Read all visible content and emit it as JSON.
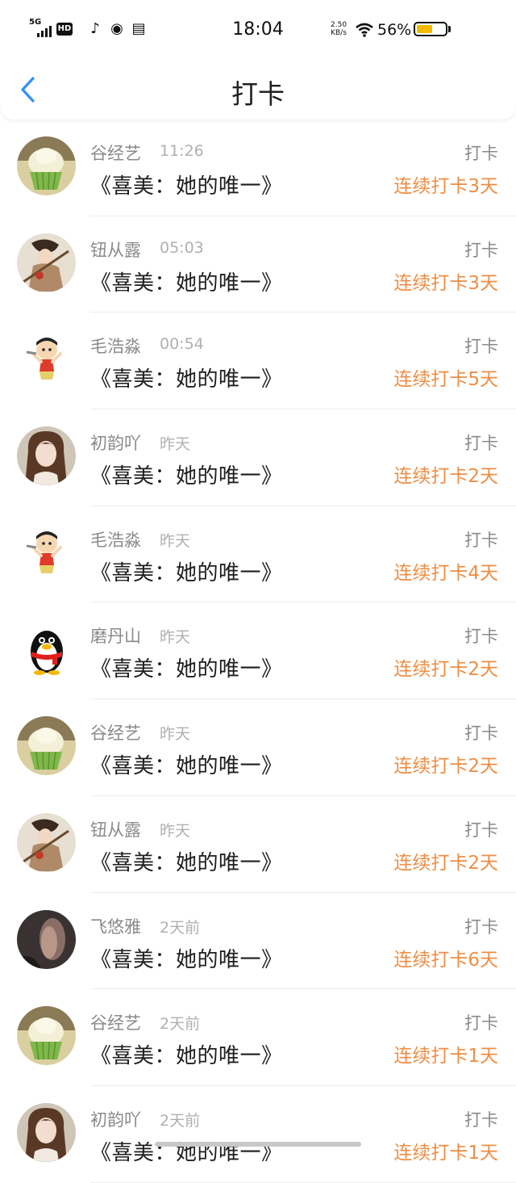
{
  "status_bar": {
    "network": "5G",
    "hd_label": "HD",
    "time": "18:04",
    "speed_value": "2.50",
    "speed_unit": "KB/s",
    "battery_text": "56%",
    "battery_level": 0.56,
    "battery_color": "#f5b800"
  },
  "header": {
    "title": "打卡",
    "back_icon": "chevron-left-icon",
    "accent": "#2f8fff"
  },
  "colors": {
    "streak": "#ee8e45",
    "muted": "#8a8a8a"
  },
  "items": [
    {
      "name": "谷经艺",
      "time": "11:26",
      "book": "《喜美：她的唯一》",
      "action": "打卡",
      "streak": "连续打卡3天",
      "avatar": "cupcake"
    },
    {
      "name": "钮从露",
      "time": "05:03",
      "book": "《喜美：她的唯一》",
      "action": "打卡",
      "streak": "连续打卡3天",
      "avatar": "warrior"
    },
    {
      "name": "毛浩淼",
      "time": "00:54",
      "book": "《喜美：她的唯一》",
      "action": "打卡",
      "streak": "连续打卡5天",
      "avatar": "cartoon-kid"
    },
    {
      "name": "初韵吖",
      "time": "昨天",
      "book": "《喜美：她的唯一》",
      "action": "打卡",
      "streak": "连续打卡2天",
      "avatar": "girl"
    },
    {
      "name": "毛浩淼",
      "time": "昨天",
      "book": "《喜美：她的唯一》",
      "action": "打卡",
      "streak": "连续打卡4天",
      "avatar": "cartoon-kid"
    },
    {
      "name": "磨丹山",
      "time": "昨天",
      "book": "《喜美：她的唯一》",
      "action": "打卡",
      "streak": "连续打卡2天",
      "avatar": "penguin"
    },
    {
      "name": "谷经艺",
      "time": "昨天",
      "book": "《喜美：她的唯一》",
      "action": "打卡",
      "streak": "连续打卡2天",
      "avatar": "cupcake"
    },
    {
      "name": "钮从露",
      "time": "昨天",
      "book": "《喜美：她的唯一》",
      "action": "打卡",
      "streak": "连续打卡2天",
      "avatar": "warrior"
    },
    {
      "name": "飞悠雅",
      "time": "2天前",
      "book": "《喜美：她的唯一》",
      "action": "打卡",
      "streak": "连续打卡6天",
      "avatar": "dark-photo"
    },
    {
      "name": "谷经艺",
      "time": "2天前",
      "book": "《喜美：她的唯一》",
      "action": "打卡",
      "streak": "连续打卡1天",
      "avatar": "cupcake"
    },
    {
      "name": "初韵吖",
      "time": "2天前",
      "book": "《喜美：她的唯一》",
      "action": "打卡",
      "streak": "连续打卡1天",
      "avatar": "girl"
    }
  ]
}
